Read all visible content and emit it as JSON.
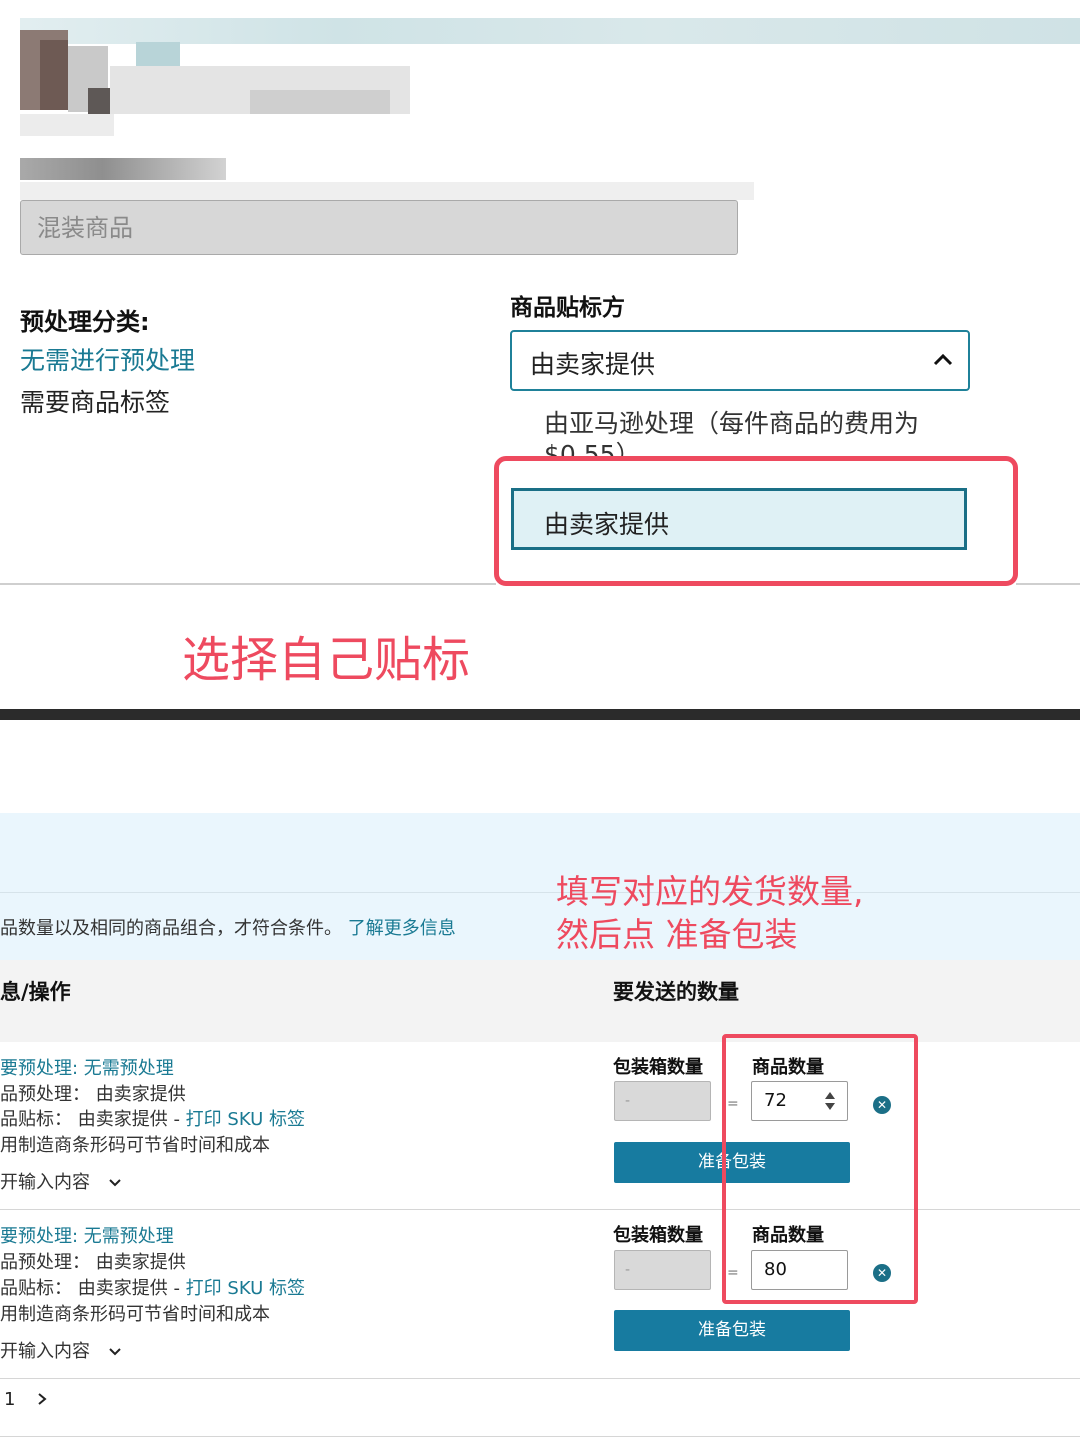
{
  "top": {
    "mixed_field": "混装商品",
    "prep_category_label": "预处理分类:",
    "prep_category_value": "无需进行预处理",
    "prep_need": "需要商品标签",
    "labeler_title": "商品贴标方",
    "labeler_selected": "由卖家提供",
    "dropdown_options": [
      "由亚马逊处理（每件商品的费用为 $0.55）",
      "由卖家提供"
    ],
    "annotation": "选择自己贴标"
  },
  "bottom": {
    "info_text": "品数量以及相同的商品组合，才符合条件。",
    "info_link": "了解更多信息",
    "annotation_line1": "填写对应的发货数量,",
    "annotation_line2": "然后点 准备包装",
    "col_info": "息/操作",
    "col_qty": "要发送的数量",
    "rows": [
      {
        "line1_prefix": "要预处理: ",
        "line1_link": "无需预处理",
        "line2": "品预处理： 由卖家提供",
        "line3_prefix": "品贴标： 由卖家提供 - ",
        "line3_link": "打印 SKU 标签",
        "line4": "用制造商条形码可节省时间和成本",
        "expand": "开输入内容",
        "box_label": "包装箱数量",
        "box_value": "-",
        "qty_label": "商品数量",
        "qty_value": "72",
        "button": "准备包装"
      },
      {
        "line1_prefix": "要预处理: ",
        "line1_link": "无需预处理",
        "line2": "品预处理： 由卖家提供",
        "line3_prefix": "品贴标： 由卖家提供 - ",
        "line3_link": "打印 SKU 标签",
        "line4": "用制造商条形码可节省时间和成本",
        "expand": "开输入内容",
        "box_label": "包装箱数量",
        "box_value": "-",
        "qty_label": "商品数量",
        "qty_value": "80",
        "button": "准备包装"
      }
    ],
    "pagination_page": "1",
    "colors": {
      "accent": "#177ba0",
      "link": "#1a7a93",
      "annotation": "#ee4a5f"
    }
  }
}
